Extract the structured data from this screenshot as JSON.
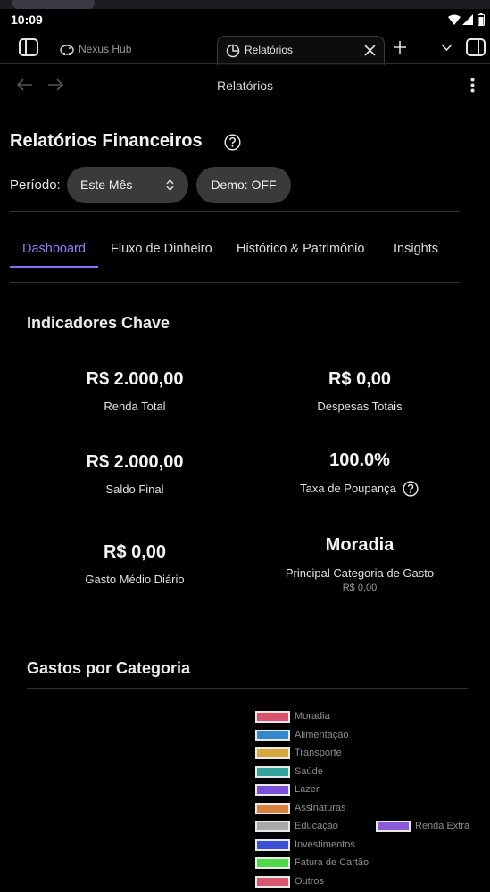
{
  "status_bar": {
    "time": "10:09"
  },
  "browser": {
    "inactive_tab_title": "Nexus Hub",
    "active_tab_title": "Relatórios",
    "page_title": "Relatórios"
  },
  "page": {
    "title": "Relatórios Financeiros",
    "period_label": "Período:",
    "period_value": "Este Mês",
    "demo_toggle_label": "Demo: OFF"
  },
  "tabs": [
    {
      "label": "Dashboard",
      "active": true
    },
    {
      "label": "Fluxo de Dinheiro",
      "active": false
    },
    {
      "label": "Histórico & Patrimônio",
      "active": false
    },
    {
      "label": "Insights",
      "active": false
    }
  ],
  "key_indicators": {
    "title": "Indicadores Chave",
    "items": [
      {
        "value": "R$ 2.000,00",
        "label": "Renda Total"
      },
      {
        "value": "R$ 0,00",
        "label": "Despesas Totais"
      },
      {
        "value": "R$ 2.000,00",
        "label": "Saldo Final"
      },
      {
        "value": "100.0%",
        "label": "Taxa de Poupança"
      },
      {
        "value": "R$ 0,00",
        "label": "Gasto Médio Diário"
      },
      {
        "value": "Moradia",
        "label": "Principal Categoria de Gasto",
        "sub": "R$ 0,00"
      }
    ]
  },
  "category_spending": {
    "title": "Gastos por Categoria",
    "legend": [
      {
        "label": "Moradia",
        "color": "#d9536f"
      },
      {
        "label": "Alimentação",
        "color": "#2f88d0"
      },
      {
        "label": "Transporte",
        "color": "#d6a83f"
      },
      {
        "label": "Saúde",
        "color": "#34a39b"
      },
      {
        "label": "Lazer",
        "color": "#7d4fd8"
      },
      {
        "label": "Assinaturas",
        "color": "#d9813c"
      },
      {
        "label": "Educação",
        "color": "#a8a8a8"
      },
      {
        "label": "Investimentos",
        "color": "#3c4ed6"
      },
      {
        "label": "Fatura de Cartão",
        "color": "#4fd84a"
      },
      {
        "label": "Outros",
        "color": "#d6566e"
      },
      {
        "label": "Renda Extra",
        "color": "#8a5ad9"
      }
    ]
  }
}
